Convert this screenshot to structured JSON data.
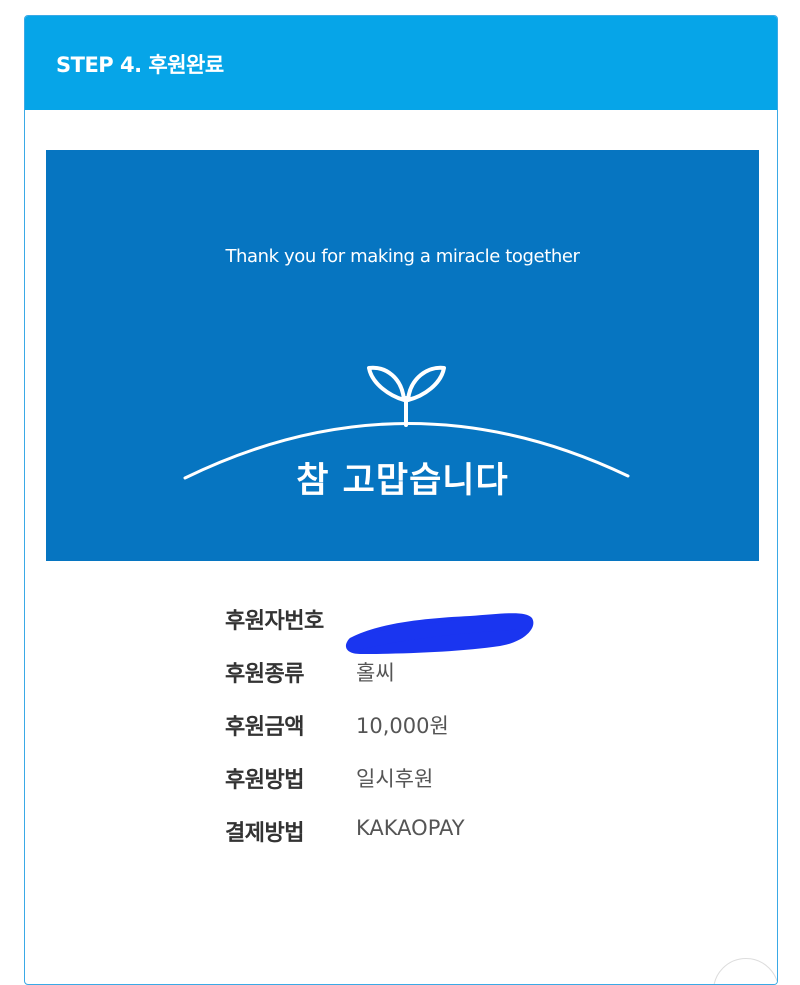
{
  "header": {
    "title": "STEP 4. 후원완료"
  },
  "banner": {
    "message_en": "Thank you for making a miracle together",
    "message_ko": "참 고맙습니다"
  },
  "colors": {
    "header_bg": "#06a5e8",
    "banner_bg": "#0675c1",
    "redaction": "#1a35f0"
  },
  "details": [
    {
      "label": "후원자번호",
      "value": ""
    },
    {
      "label": "후원종류",
      "value": "홀씨"
    },
    {
      "label": "후원금액",
      "value": "10,000원"
    },
    {
      "label": "후원방법",
      "value": "일시후원"
    },
    {
      "label": "결제방법",
      "value": "KAKAOPAY"
    }
  ]
}
